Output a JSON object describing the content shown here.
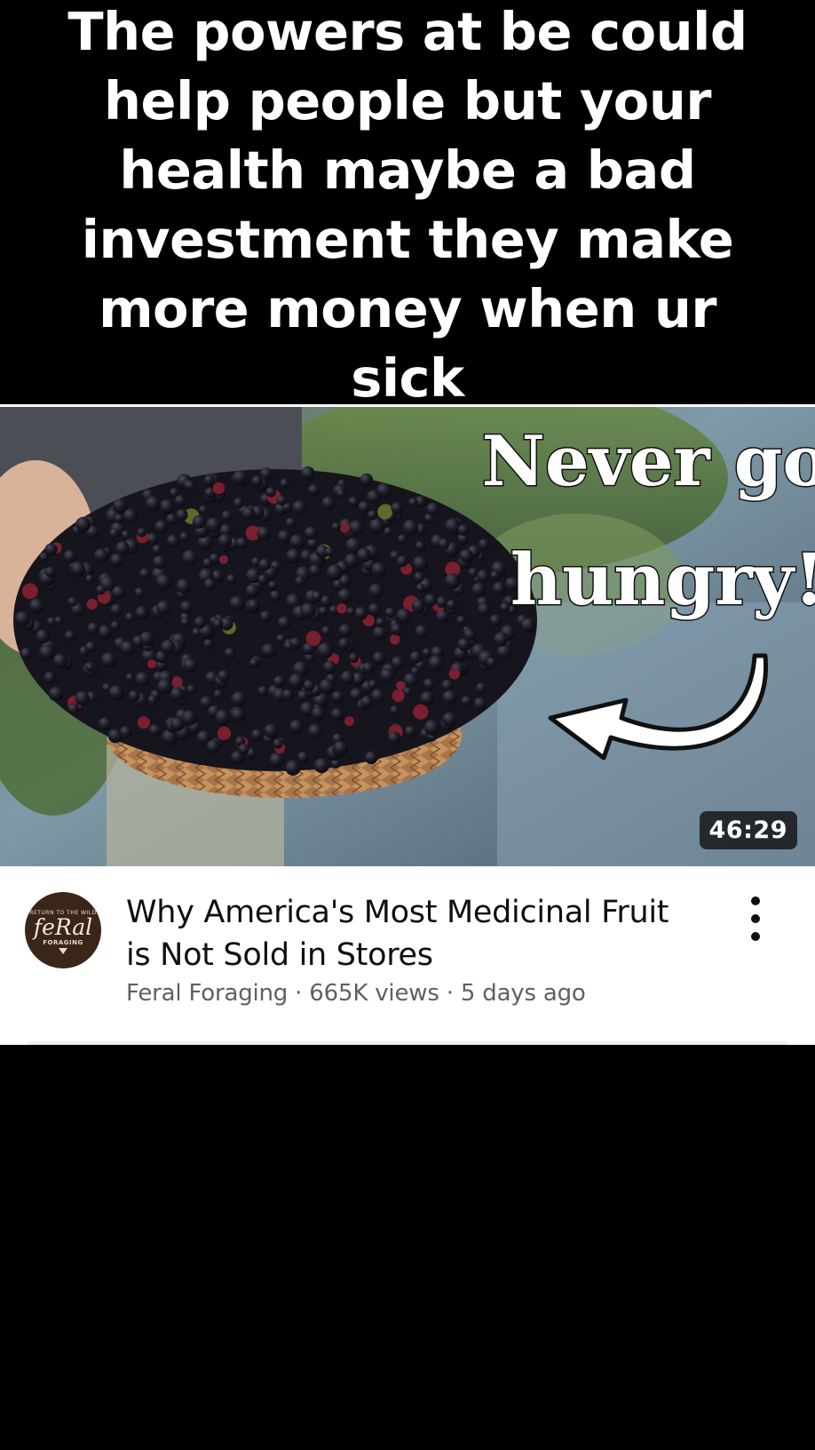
{
  "caption": {
    "line1": "The powers at be could",
    "line2": "help people but your",
    "line3": "health maybe a bad",
    "line4": "investment they make",
    "line5": "more money when ur sick"
  },
  "thumbnail": {
    "overlay_line1": "Never go",
    "overlay_line2": "hungry!",
    "duration": "46:29",
    "arrow_icon": "curved-arrow-left-icon"
  },
  "video": {
    "title_line1": "Why America's Most Medicinal Fruit",
    "title_line2": "is Not Sold in Stores",
    "channel": "Feral Foraging",
    "views": "665K views",
    "age": "5 days ago",
    "meta": "Feral Foraging · 665K views · 5 days ago",
    "more_icon": "more-vert-icon"
  },
  "avatar": {
    "top_text": "RETURN TO THE WILD",
    "word": "feRal",
    "sub": "FORAGING"
  },
  "colors": {
    "background": "#000000",
    "card": "#ffffff",
    "title": "#0f0f0f",
    "meta": "#606060",
    "avatar_bg": "#3a2618"
  }
}
